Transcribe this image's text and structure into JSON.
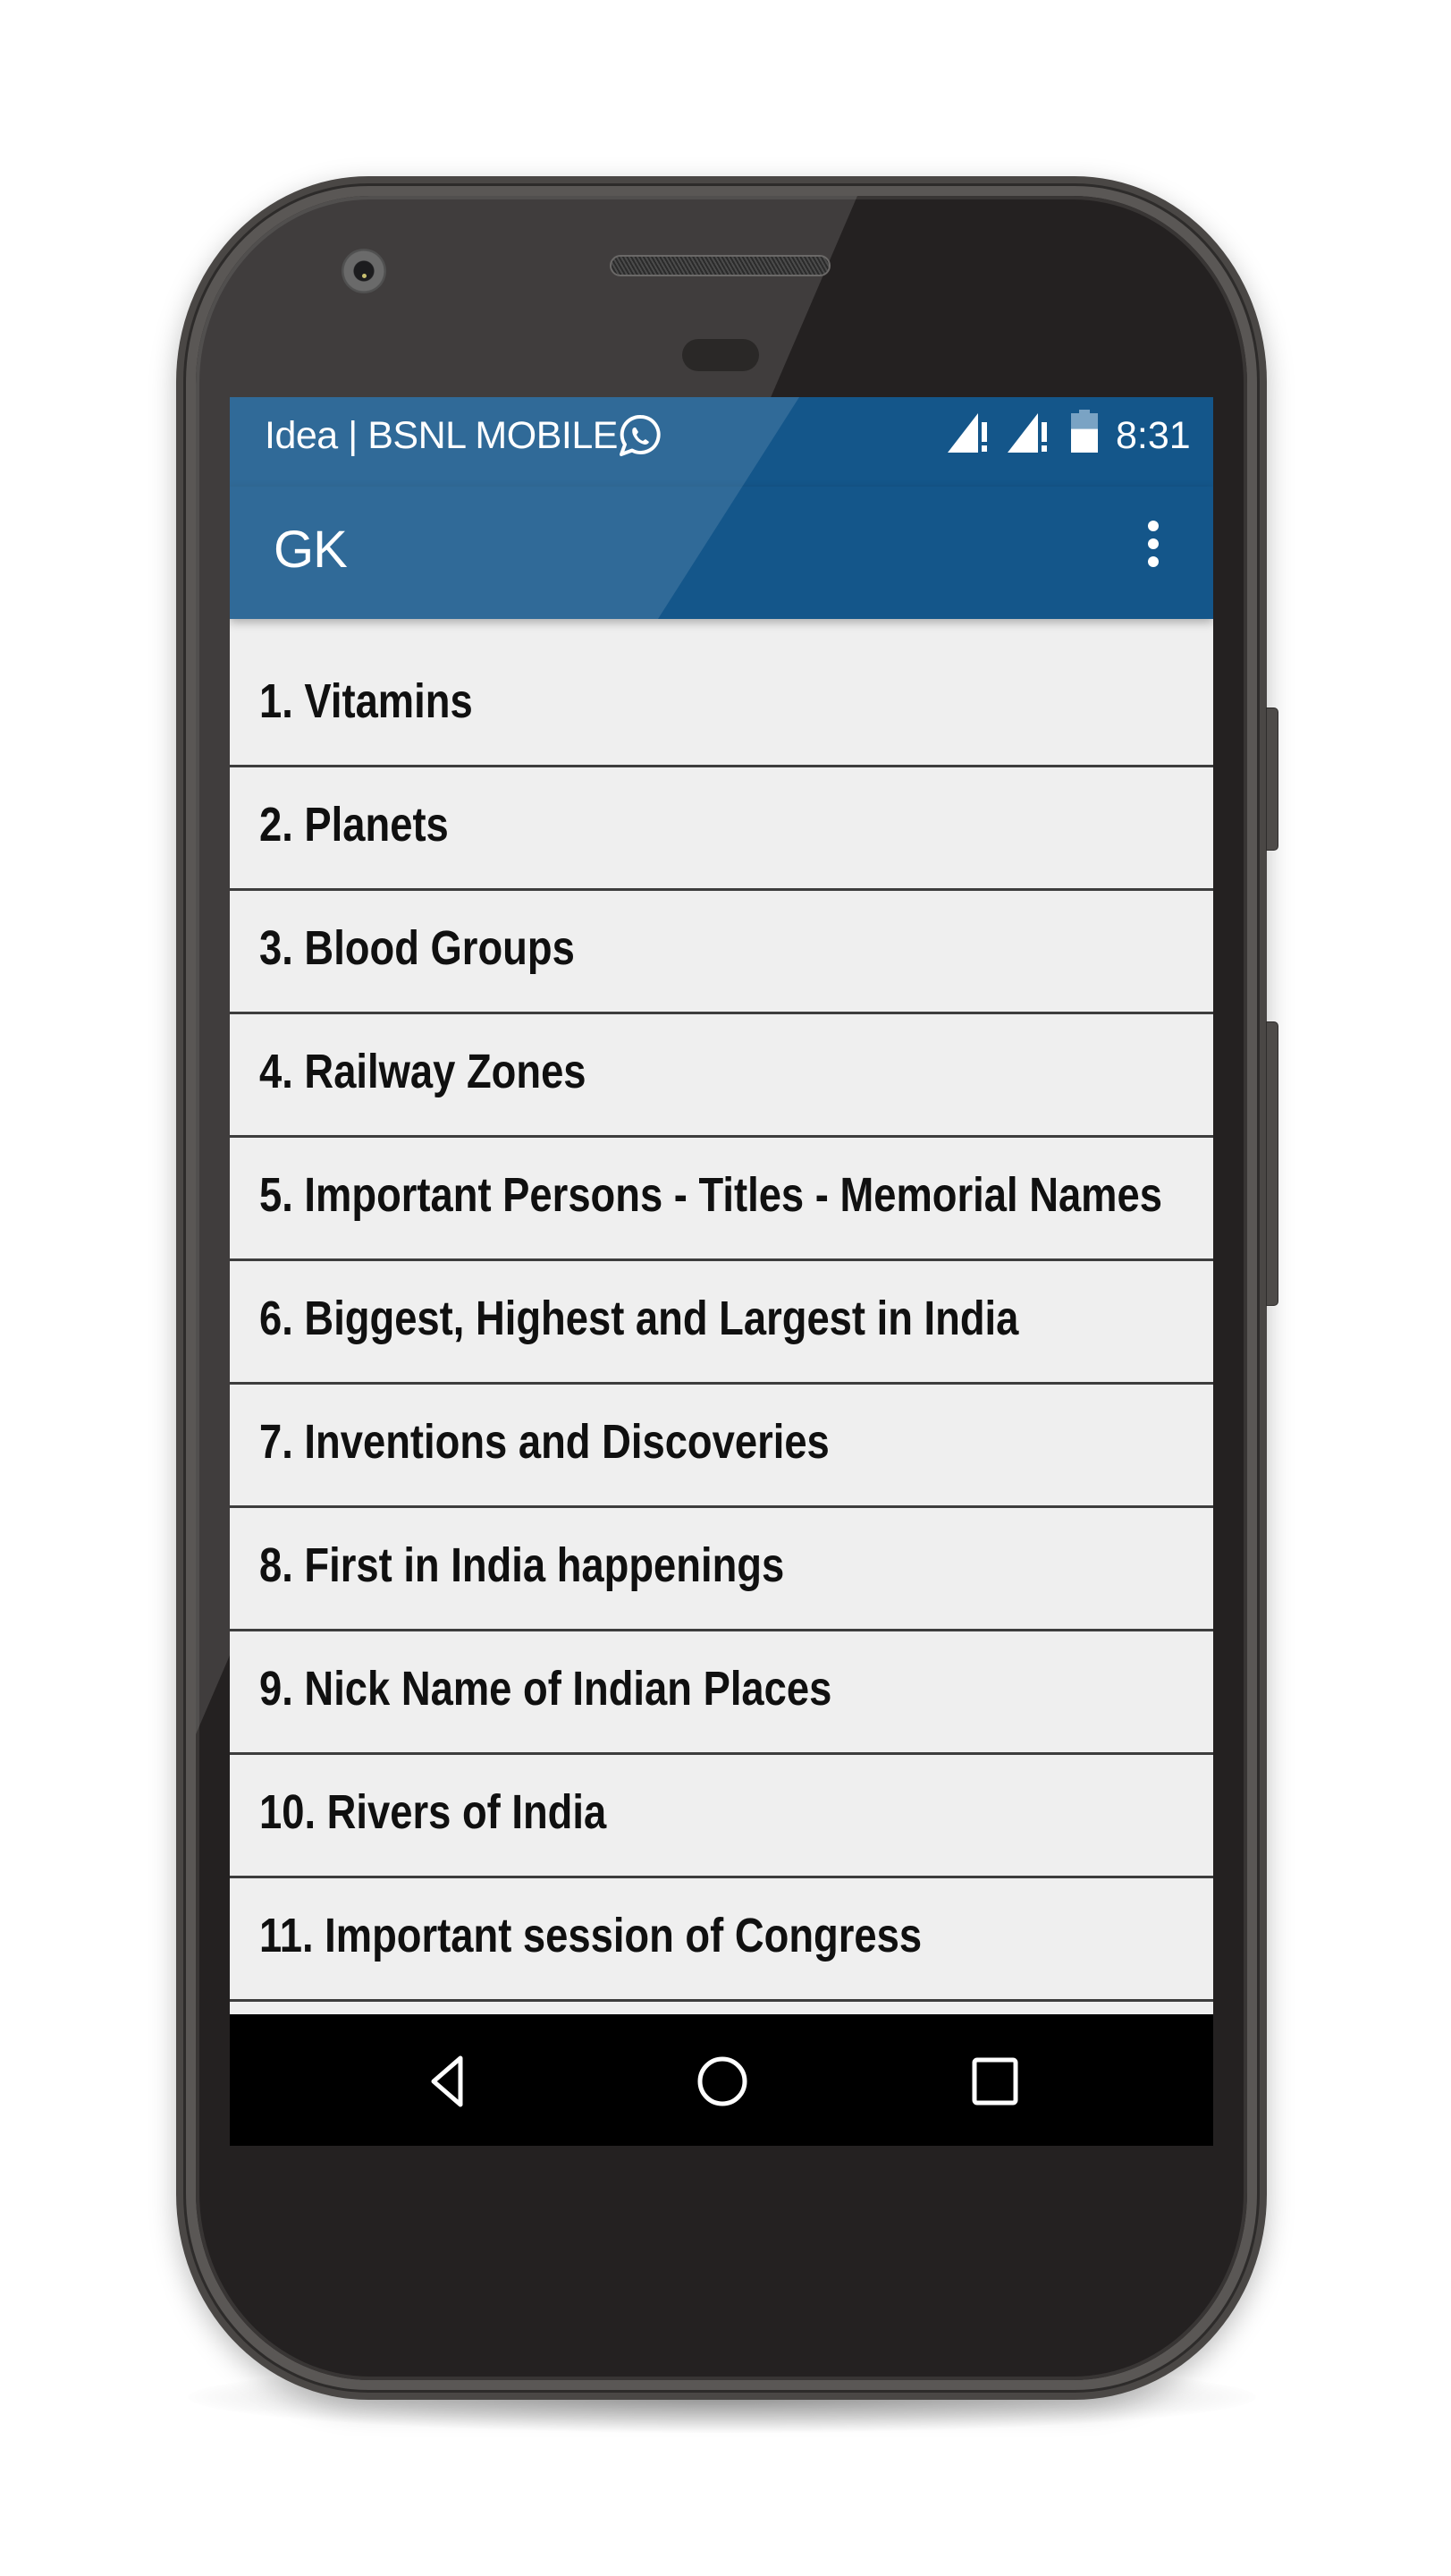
{
  "status_bar": {
    "carrier": "Idea | BSNL MOBILE",
    "notification_icon": "whatsapp-icon",
    "signal_icons": [
      "signal-no-data-icon",
      "signal-no-data-icon"
    ],
    "battery_icon": "battery-icon",
    "battery_level_fraction": 0.6,
    "time": "8:31"
  },
  "app_bar": {
    "title": "GK",
    "menu_icon": "overflow-menu-icon",
    "color": "#14568a"
  },
  "list": {
    "items": [
      {
        "label": "1. Vitamins"
      },
      {
        "label": "2. Planets"
      },
      {
        "label": "3. Blood Groups"
      },
      {
        "label": "4. Railway Zones"
      },
      {
        "label": "5. Important Persons - Titles - Memorial Names"
      },
      {
        "label": "6. Biggest, Highest and Largest in India"
      },
      {
        "label": "7. Inventions and Discoveries"
      },
      {
        "label": "8. First in India happenings"
      },
      {
        "label": "9. Nick Name of Indian Places"
      },
      {
        "label": "10. Rivers of India"
      },
      {
        "label": "11. Important session of Congress"
      }
    ]
  },
  "nav_bar": {
    "back": "back-icon",
    "home": "home-icon",
    "recents": "recents-icon"
  },
  "colors": {
    "app_bar": "#14568a",
    "list_background": "#efefef",
    "divider": "#3d3d3d",
    "nav_bar": "#000000"
  }
}
